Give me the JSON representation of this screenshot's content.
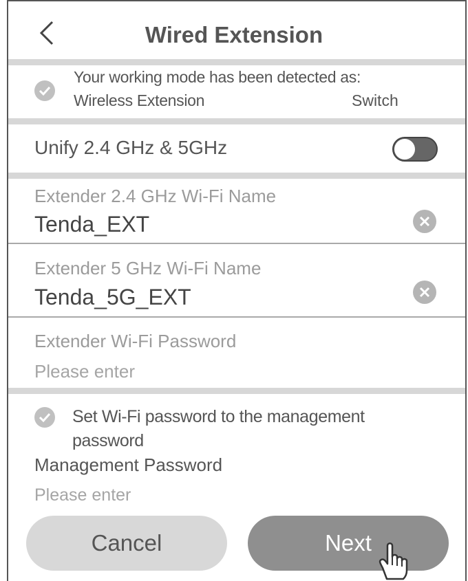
{
  "header": {
    "title": "Wired Extension",
    "back_icon": "chevron-left-icon"
  },
  "mode": {
    "line1": "Your working mode has been detected as:",
    "line2_left": "Wireless Extension",
    "line2_right": "Switch",
    "checked": true
  },
  "unify": {
    "label": "Unify 2.4 GHz & 5GHz",
    "enabled": false
  },
  "wifi24": {
    "label": "Extender 2.4 GHz Wi-Fi Name",
    "value": "Tenda_EXT"
  },
  "wifi5": {
    "label": "Extender 5 GHz Wi-Fi Name",
    "value": "Tenda_5G_EXT"
  },
  "wifi_password": {
    "label": "Extender Wi-Fi Password",
    "placeholder": "Please enter"
  },
  "set_password": {
    "line1": "Set Wi-Fi password to the management",
    "line2": "password",
    "checked": true
  },
  "management_password": {
    "label": "Management Password",
    "placeholder": "Please enter"
  },
  "buttons": {
    "cancel": "Cancel",
    "next": "Next"
  },
  "colors": {
    "separator": "#d7d7d7",
    "next_button": "#8f8f8f",
    "cancel_button": "#d8d8d8",
    "check_icon": "#c0c0c0"
  }
}
